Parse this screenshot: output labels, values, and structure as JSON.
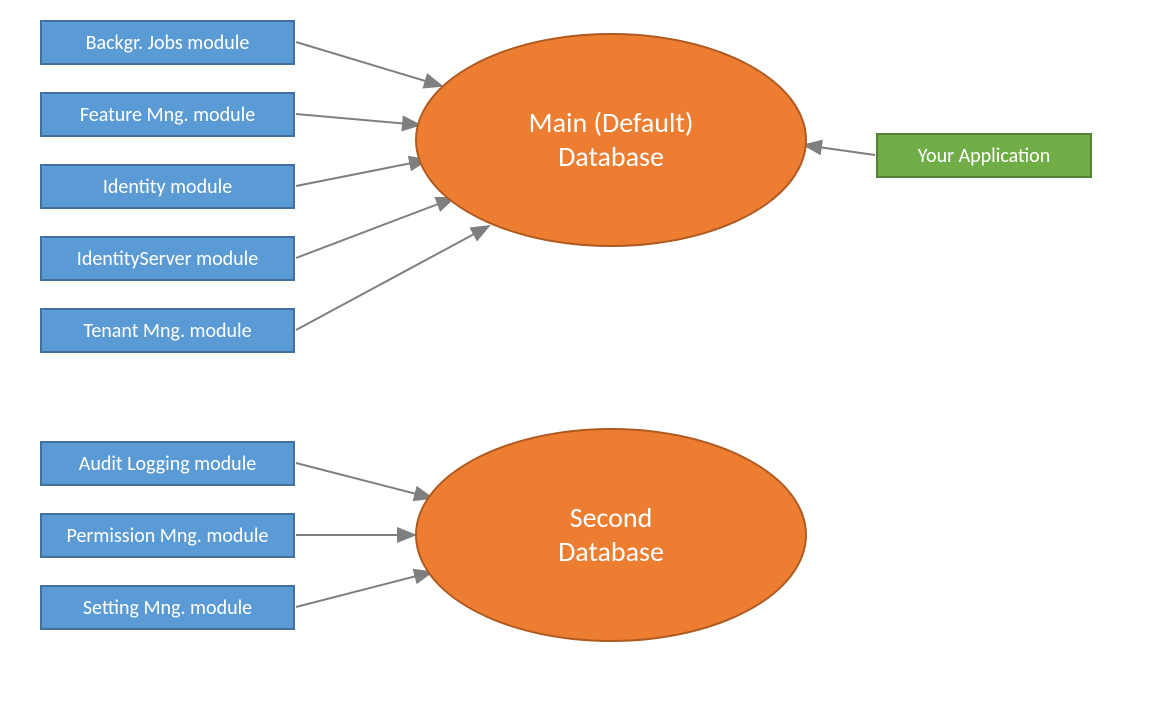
{
  "modules_top": [
    {
      "label": "Backgr. Jobs module"
    },
    {
      "label": "Feature Mng. module"
    },
    {
      "label": "Identity module"
    },
    {
      "label": "IdentityServer module"
    },
    {
      "label": "Tenant Mng. module"
    }
  ],
  "modules_bottom": [
    {
      "label": "Audit Logging module"
    },
    {
      "label": "Permission Mng. module"
    },
    {
      "label": "Setting Mng. module"
    }
  ],
  "db_main": {
    "line1": "Main (Default)",
    "line2": "Database"
  },
  "db_second": {
    "line1": "Second",
    "line2": "Database"
  },
  "app": {
    "label": "Your Application"
  },
  "colors": {
    "module_fill": "#5b9bd5",
    "module_border": "#41719c",
    "app_fill": "#70ad47",
    "app_border": "#548235",
    "db_fill": "#ed7d31",
    "db_border": "#ae5a21",
    "arrow": "#7f7f7f"
  }
}
